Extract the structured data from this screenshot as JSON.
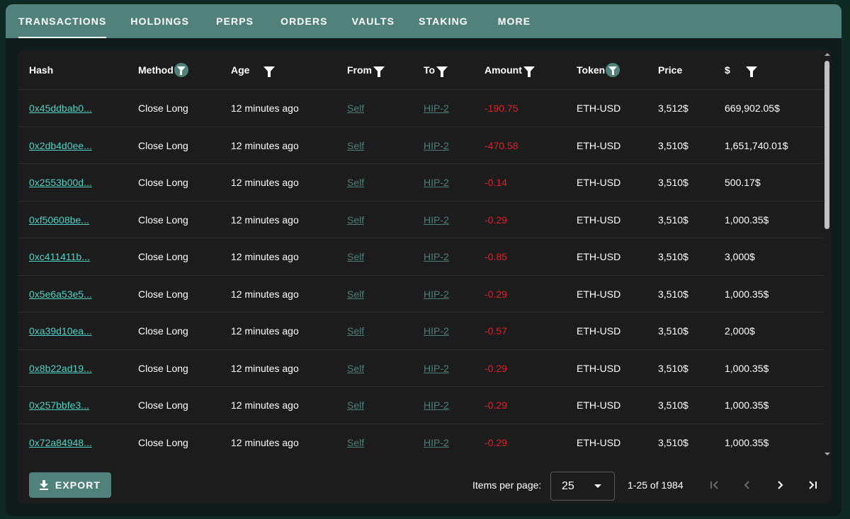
{
  "tabs": [
    {
      "label": "TRANSACTIONS",
      "active": true
    },
    {
      "label": "HOLDINGS",
      "active": false
    },
    {
      "label": "PERPS",
      "active": false
    },
    {
      "label": "ORDERS",
      "active": false
    },
    {
      "label": "VAULTS",
      "active": false
    },
    {
      "label": "STAKING",
      "active": false
    },
    {
      "label": "MORE",
      "active": false
    }
  ],
  "table": {
    "columns": [
      "Hash",
      "Method",
      "Age",
      "From",
      "To",
      "Amount",
      "Token",
      "Price",
      "$"
    ],
    "rows": [
      {
        "hash": "0x45ddbab0...",
        "method": "Close Long",
        "age": "12 minutes ago",
        "from": "Self",
        "to": "HIP-2",
        "amount": "-190.75",
        "token": "ETH-USD",
        "price": "3,512$",
        "usd": "669,902.05$"
      },
      {
        "hash": "0x2db4d0ee...",
        "method": "Close Long",
        "age": "12 minutes ago",
        "from": "Self",
        "to": "HIP-2",
        "amount": "-470.58",
        "token": "ETH-USD",
        "price": "3,510$",
        "usd": "1,651,740.01$"
      },
      {
        "hash": "0x2553b00d...",
        "method": "Close Long",
        "age": "12 minutes ago",
        "from": "Self",
        "to": "HIP-2",
        "amount": "-0.14",
        "token": "ETH-USD",
        "price": "3,510$",
        "usd": "500.17$"
      },
      {
        "hash": "0xf50608be...",
        "method": "Close Long",
        "age": "12 minutes ago",
        "from": "Self",
        "to": "HIP-2",
        "amount": "-0.29",
        "token": "ETH-USD",
        "price": "3,510$",
        "usd": "1,000.35$"
      },
      {
        "hash": "0xc411411b...",
        "method": "Close Long",
        "age": "12 minutes ago",
        "from": "Self",
        "to": "HIP-2",
        "amount": "-0.85",
        "token": "ETH-USD",
        "price": "3,510$",
        "usd": "3,000$"
      },
      {
        "hash": "0x5e6a53e5...",
        "method": "Close Long",
        "age": "12 minutes ago",
        "from": "Self",
        "to": "HIP-2",
        "amount": "-0.29",
        "token": "ETH-USD",
        "price": "3,510$",
        "usd": "1,000.35$"
      },
      {
        "hash": "0xa39d10ea...",
        "method": "Close Long",
        "age": "12 minutes ago",
        "from": "Self",
        "to": "HIP-2",
        "amount": "-0.57",
        "token": "ETH-USD",
        "price": "3,510$",
        "usd": "2,000$"
      },
      {
        "hash": "0x8b22ad19...",
        "method": "Close Long",
        "age": "12 minutes ago",
        "from": "Self",
        "to": "HIP-2",
        "amount": "-0.29",
        "token": "ETH-USD",
        "price": "3,510$",
        "usd": "1,000.35$"
      },
      {
        "hash": "0x257bbfe3...",
        "method": "Close Long",
        "age": "12 minutes ago",
        "from": "Self",
        "to": "HIP-2",
        "amount": "-0.29",
        "token": "ETH-USD",
        "price": "3,510$",
        "usd": "1,000.35$"
      },
      {
        "hash": "0x72a84948...",
        "method": "Close Long",
        "age": "12 minutes ago",
        "from": "Self",
        "to": "HIP-2",
        "amount": "-0.29",
        "token": "ETH-USD",
        "price": "3,510$",
        "usd": "1,000.35$"
      }
    ]
  },
  "footer": {
    "export_label": "EXPORT",
    "items_per_page_label": "Items per page:",
    "items_per_page_value": "25",
    "range_label": "1-25 of 1984"
  },
  "icons": {
    "filter": "filter-icon",
    "download": "download-icon",
    "first_page": "first-page-icon",
    "prev_page": "chevron-left-icon",
    "next_page": "chevron-right-icon",
    "last_page": "last-page-icon"
  },
  "colors": {
    "accent": "#50817a",
    "hash_link": "#4fd3c4",
    "muted_link": "#4d7f79",
    "negative": "#e0202a",
    "card_bg": "#1c1c1c"
  }
}
